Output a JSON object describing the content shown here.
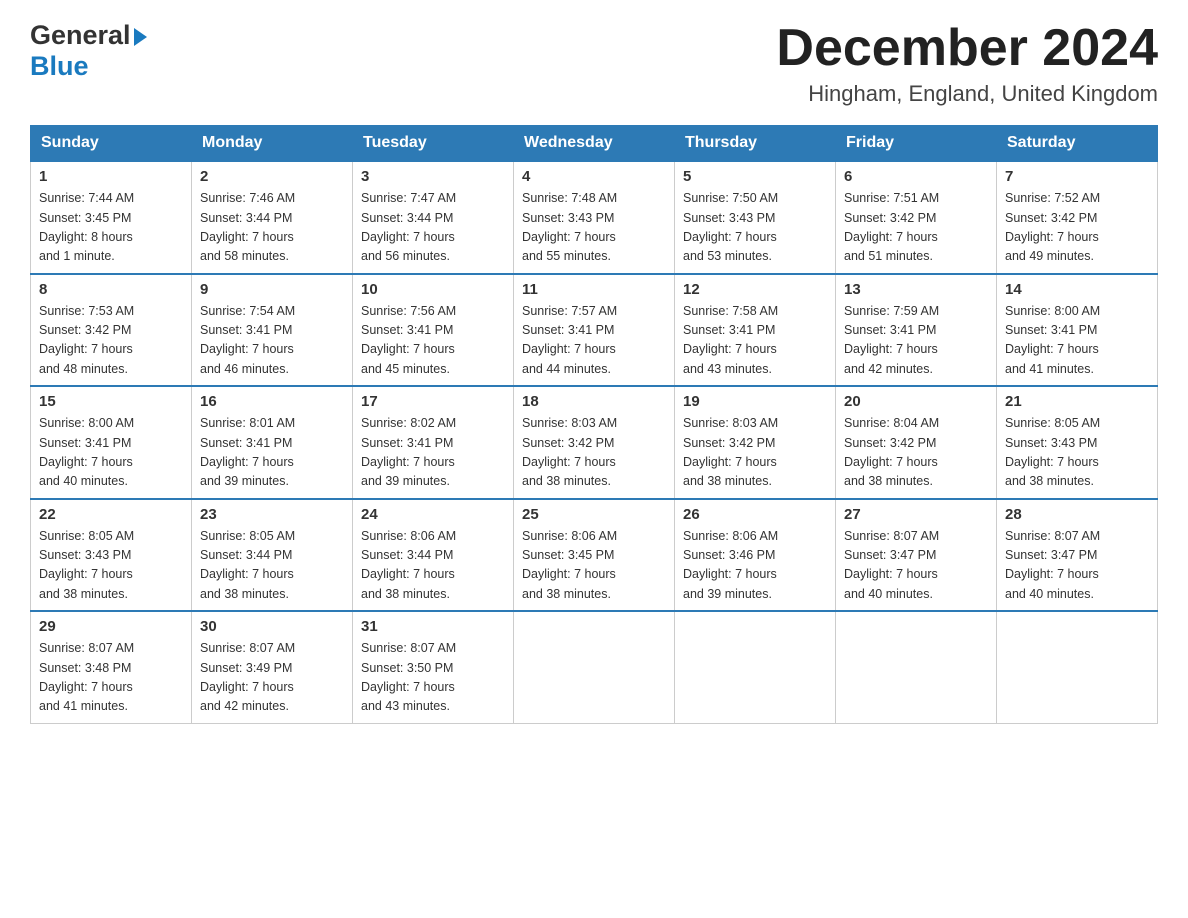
{
  "header": {
    "logo_general": "General",
    "logo_blue": "Blue",
    "title": "December 2024",
    "subtitle": "Hingham, England, United Kingdom"
  },
  "days_of_week": [
    "Sunday",
    "Monday",
    "Tuesday",
    "Wednesday",
    "Thursday",
    "Friday",
    "Saturday"
  ],
  "weeks": [
    [
      {
        "day": "1",
        "sunrise": "Sunrise: 7:44 AM",
        "sunset": "Sunset: 3:45 PM",
        "daylight": "Daylight: 8 hours",
        "daylight2": "and 1 minute."
      },
      {
        "day": "2",
        "sunrise": "Sunrise: 7:46 AM",
        "sunset": "Sunset: 3:44 PM",
        "daylight": "Daylight: 7 hours",
        "daylight2": "and 58 minutes."
      },
      {
        "day": "3",
        "sunrise": "Sunrise: 7:47 AM",
        "sunset": "Sunset: 3:44 PM",
        "daylight": "Daylight: 7 hours",
        "daylight2": "and 56 minutes."
      },
      {
        "day": "4",
        "sunrise": "Sunrise: 7:48 AM",
        "sunset": "Sunset: 3:43 PM",
        "daylight": "Daylight: 7 hours",
        "daylight2": "and 55 minutes."
      },
      {
        "day": "5",
        "sunrise": "Sunrise: 7:50 AM",
        "sunset": "Sunset: 3:43 PM",
        "daylight": "Daylight: 7 hours",
        "daylight2": "and 53 minutes."
      },
      {
        "day": "6",
        "sunrise": "Sunrise: 7:51 AM",
        "sunset": "Sunset: 3:42 PM",
        "daylight": "Daylight: 7 hours",
        "daylight2": "and 51 minutes."
      },
      {
        "day": "7",
        "sunrise": "Sunrise: 7:52 AM",
        "sunset": "Sunset: 3:42 PM",
        "daylight": "Daylight: 7 hours",
        "daylight2": "and 49 minutes."
      }
    ],
    [
      {
        "day": "8",
        "sunrise": "Sunrise: 7:53 AM",
        "sunset": "Sunset: 3:42 PM",
        "daylight": "Daylight: 7 hours",
        "daylight2": "and 48 minutes."
      },
      {
        "day": "9",
        "sunrise": "Sunrise: 7:54 AM",
        "sunset": "Sunset: 3:41 PM",
        "daylight": "Daylight: 7 hours",
        "daylight2": "and 46 minutes."
      },
      {
        "day": "10",
        "sunrise": "Sunrise: 7:56 AM",
        "sunset": "Sunset: 3:41 PM",
        "daylight": "Daylight: 7 hours",
        "daylight2": "and 45 minutes."
      },
      {
        "day": "11",
        "sunrise": "Sunrise: 7:57 AM",
        "sunset": "Sunset: 3:41 PM",
        "daylight": "Daylight: 7 hours",
        "daylight2": "and 44 minutes."
      },
      {
        "day": "12",
        "sunrise": "Sunrise: 7:58 AM",
        "sunset": "Sunset: 3:41 PM",
        "daylight": "Daylight: 7 hours",
        "daylight2": "and 43 minutes."
      },
      {
        "day": "13",
        "sunrise": "Sunrise: 7:59 AM",
        "sunset": "Sunset: 3:41 PM",
        "daylight": "Daylight: 7 hours",
        "daylight2": "and 42 minutes."
      },
      {
        "day": "14",
        "sunrise": "Sunrise: 8:00 AM",
        "sunset": "Sunset: 3:41 PM",
        "daylight": "Daylight: 7 hours",
        "daylight2": "and 41 minutes."
      }
    ],
    [
      {
        "day": "15",
        "sunrise": "Sunrise: 8:00 AM",
        "sunset": "Sunset: 3:41 PM",
        "daylight": "Daylight: 7 hours",
        "daylight2": "and 40 minutes."
      },
      {
        "day": "16",
        "sunrise": "Sunrise: 8:01 AM",
        "sunset": "Sunset: 3:41 PM",
        "daylight": "Daylight: 7 hours",
        "daylight2": "and 39 minutes."
      },
      {
        "day": "17",
        "sunrise": "Sunrise: 8:02 AM",
        "sunset": "Sunset: 3:41 PM",
        "daylight": "Daylight: 7 hours",
        "daylight2": "and 39 minutes."
      },
      {
        "day": "18",
        "sunrise": "Sunrise: 8:03 AM",
        "sunset": "Sunset: 3:42 PM",
        "daylight": "Daylight: 7 hours",
        "daylight2": "and 38 minutes."
      },
      {
        "day": "19",
        "sunrise": "Sunrise: 8:03 AM",
        "sunset": "Sunset: 3:42 PM",
        "daylight": "Daylight: 7 hours",
        "daylight2": "and 38 minutes."
      },
      {
        "day": "20",
        "sunrise": "Sunrise: 8:04 AM",
        "sunset": "Sunset: 3:42 PM",
        "daylight": "Daylight: 7 hours",
        "daylight2": "and 38 minutes."
      },
      {
        "day": "21",
        "sunrise": "Sunrise: 8:05 AM",
        "sunset": "Sunset: 3:43 PM",
        "daylight": "Daylight: 7 hours",
        "daylight2": "and 38 minutes."
      }
    ],
    [
      {
        "day": "22",
        "sunrise": "Sunrise: 8:05 AM",
        "sunset": "Sunset: 3:43 PM",
        "daylight": "Daylight: 7 hours",
        "daylight2": "and 38 minutes."
      },
      {
        "day": "23",
        "sunrise": "Sunrise: 8:05 AM",
        "sunset": "Sunset: 3:44 PM",
        "daylight": "Daylight: 7 hours",
        "daylight2": "and 38 minutes."
      },
      {
        "day": "24",
        "sunrise": "Sunrise: 8:06 AM",
        "sunset": "Sunset: 3:44 PM",
        "daylight": "Daylight: 7 hours",
        "daylight2": "and 38 minutes."
      },
      {
        "day": "25",
        "sunrise": "Sunrise: 8:06 AM",
        "sunset": "Sunset: 3:45 PM",
        "daylight": "Daylight: 7 hours",
        "daylight2": "and 38 minutes."
      },
      {
        "day": "26",
        "sunrise": "Sunrise: 8:06 AM",
        "sunset": "Sunset: 3:46 PM",
        "daylight": "Daylight: 7 hours",
        "daylight2": "and 39 minutes."
      },
      {
        "day": "27",
        "sunrise": "Sunrise: 8:07 AM",
        "sunset": "Sunset: 3:47 PM",
        "daylight": "Daylight: 7 hours",
        "daylight2": "and 40 minutes."
      },
      {
        "day": "28",
        "sunrise": "Sunrise: 8:07 AM",
        "sunset": "Sunset: 3:47 PM",
        "daylight": "Daylight: 7 hours",
        "daylight2": "and 40 minutes."
      }
    ],
    [
      {
        "day": "29",
        "sunrise": "Sunrise: 8:07 AM",
        "sunset": "Sunset: 3:48 PM",
        "daylight": "Daylight: 7 hours",
        "daylight2": "and 41 minutes."
      },
      {
        "day": "30",
        "sunrise": "Sunrise: 8:07 AM",
        "sunset": "Sunset: 3:49 PM",
        "daylight": "Daylight: 7 hours",
        "daylight2": "and 42 minutes."
      },
      {
        "day": "31",
        "sunrise": "Sunrise: 8:07 AM",
        "sunset": "Sunset: 3:50 PM",
        "daylight": "Daylight: 7 hours",
        "daylight2": "and 43 minutes."
      },
      null,
      null,
      null,
      null
    ]
  ]
}
